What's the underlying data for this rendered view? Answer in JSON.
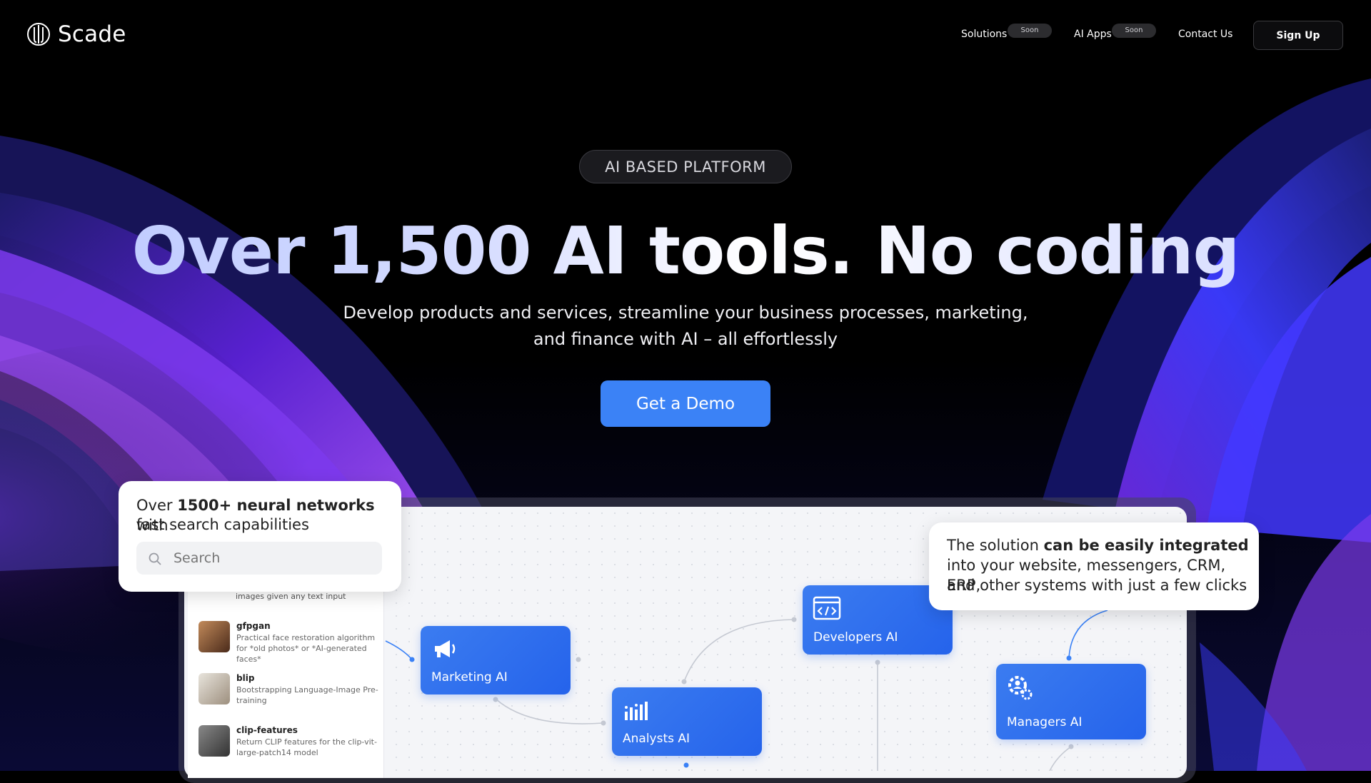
{
  "nav": {
    "logo_text": "Scade",
    "items": [
      {
        "label": "Solutions",
        "badge": "Soon"
      },
      {
        "label": "AI Apps",
        "badge": "Soon"
      },
      {
        "label": "Contact Us"
      }
    ],
    "signup_label": "Sign Up"
  },
  "hero": {
    "pill": "AI BASED PLATFORM",
    "headline": "Over 1,500 AI tools. No coding",
    "sub_line1": "Develop products and services, streamline your business processes, marketing,",
    "sub_line2": "and finance with AI – all effortlessly",
    "cta_label": "Get a Demo"
  },
  "callout_left": {
    "pre": "Over ",
    "bold": "1500+ neural networks",
    "post": " with",
    "line2": "fast search capabilities",
    "search_placeholder": "Search"
  },
  "callout_right": {
    "pre": "The solution ",
    "bold": "can be easily integrated",
    "line2": "into your website, messengers, CRM, ERP,",
    "line3": "and other systems with just a few clicks"
  },
  "model_list": {
    "cut_text": "images given any text input",
    "items": [
      {
        "name": "gfpgan",
        "desc": "Practical face restoration algorithm for *old photos* or *AI-generated faces*"
      },
      {
        "name": "blip",
        "desc": "Bootstrapping Language-Image Pre-training"
      },
      {
        "name": "clip-features",
        "desc": "Return CLIP features for the clip-vit-large-patch14 model"
      }
    ]
  },
  "flow_cards": [
    {
      "label": "Marketing AI",
      "icon": "megaphone-icon"
    },
    {
      "label": "Analysts AI",
      "icon": "bar-chart-icon"
    },
    {
      "label": "Developers AI",
      "icon": "code-window-icon"
    },
    {
      "label": "Managers AI",
      "icon": "gear-person-icon"
    }
  ],
  "colors": {
    "accent": "#3b82f6",
    "card": "#2563eb",
    "background": "#000000",
    "wave_purple": "#7c3aed",
    "wave_blue": "#3b3bff"
  }
}
